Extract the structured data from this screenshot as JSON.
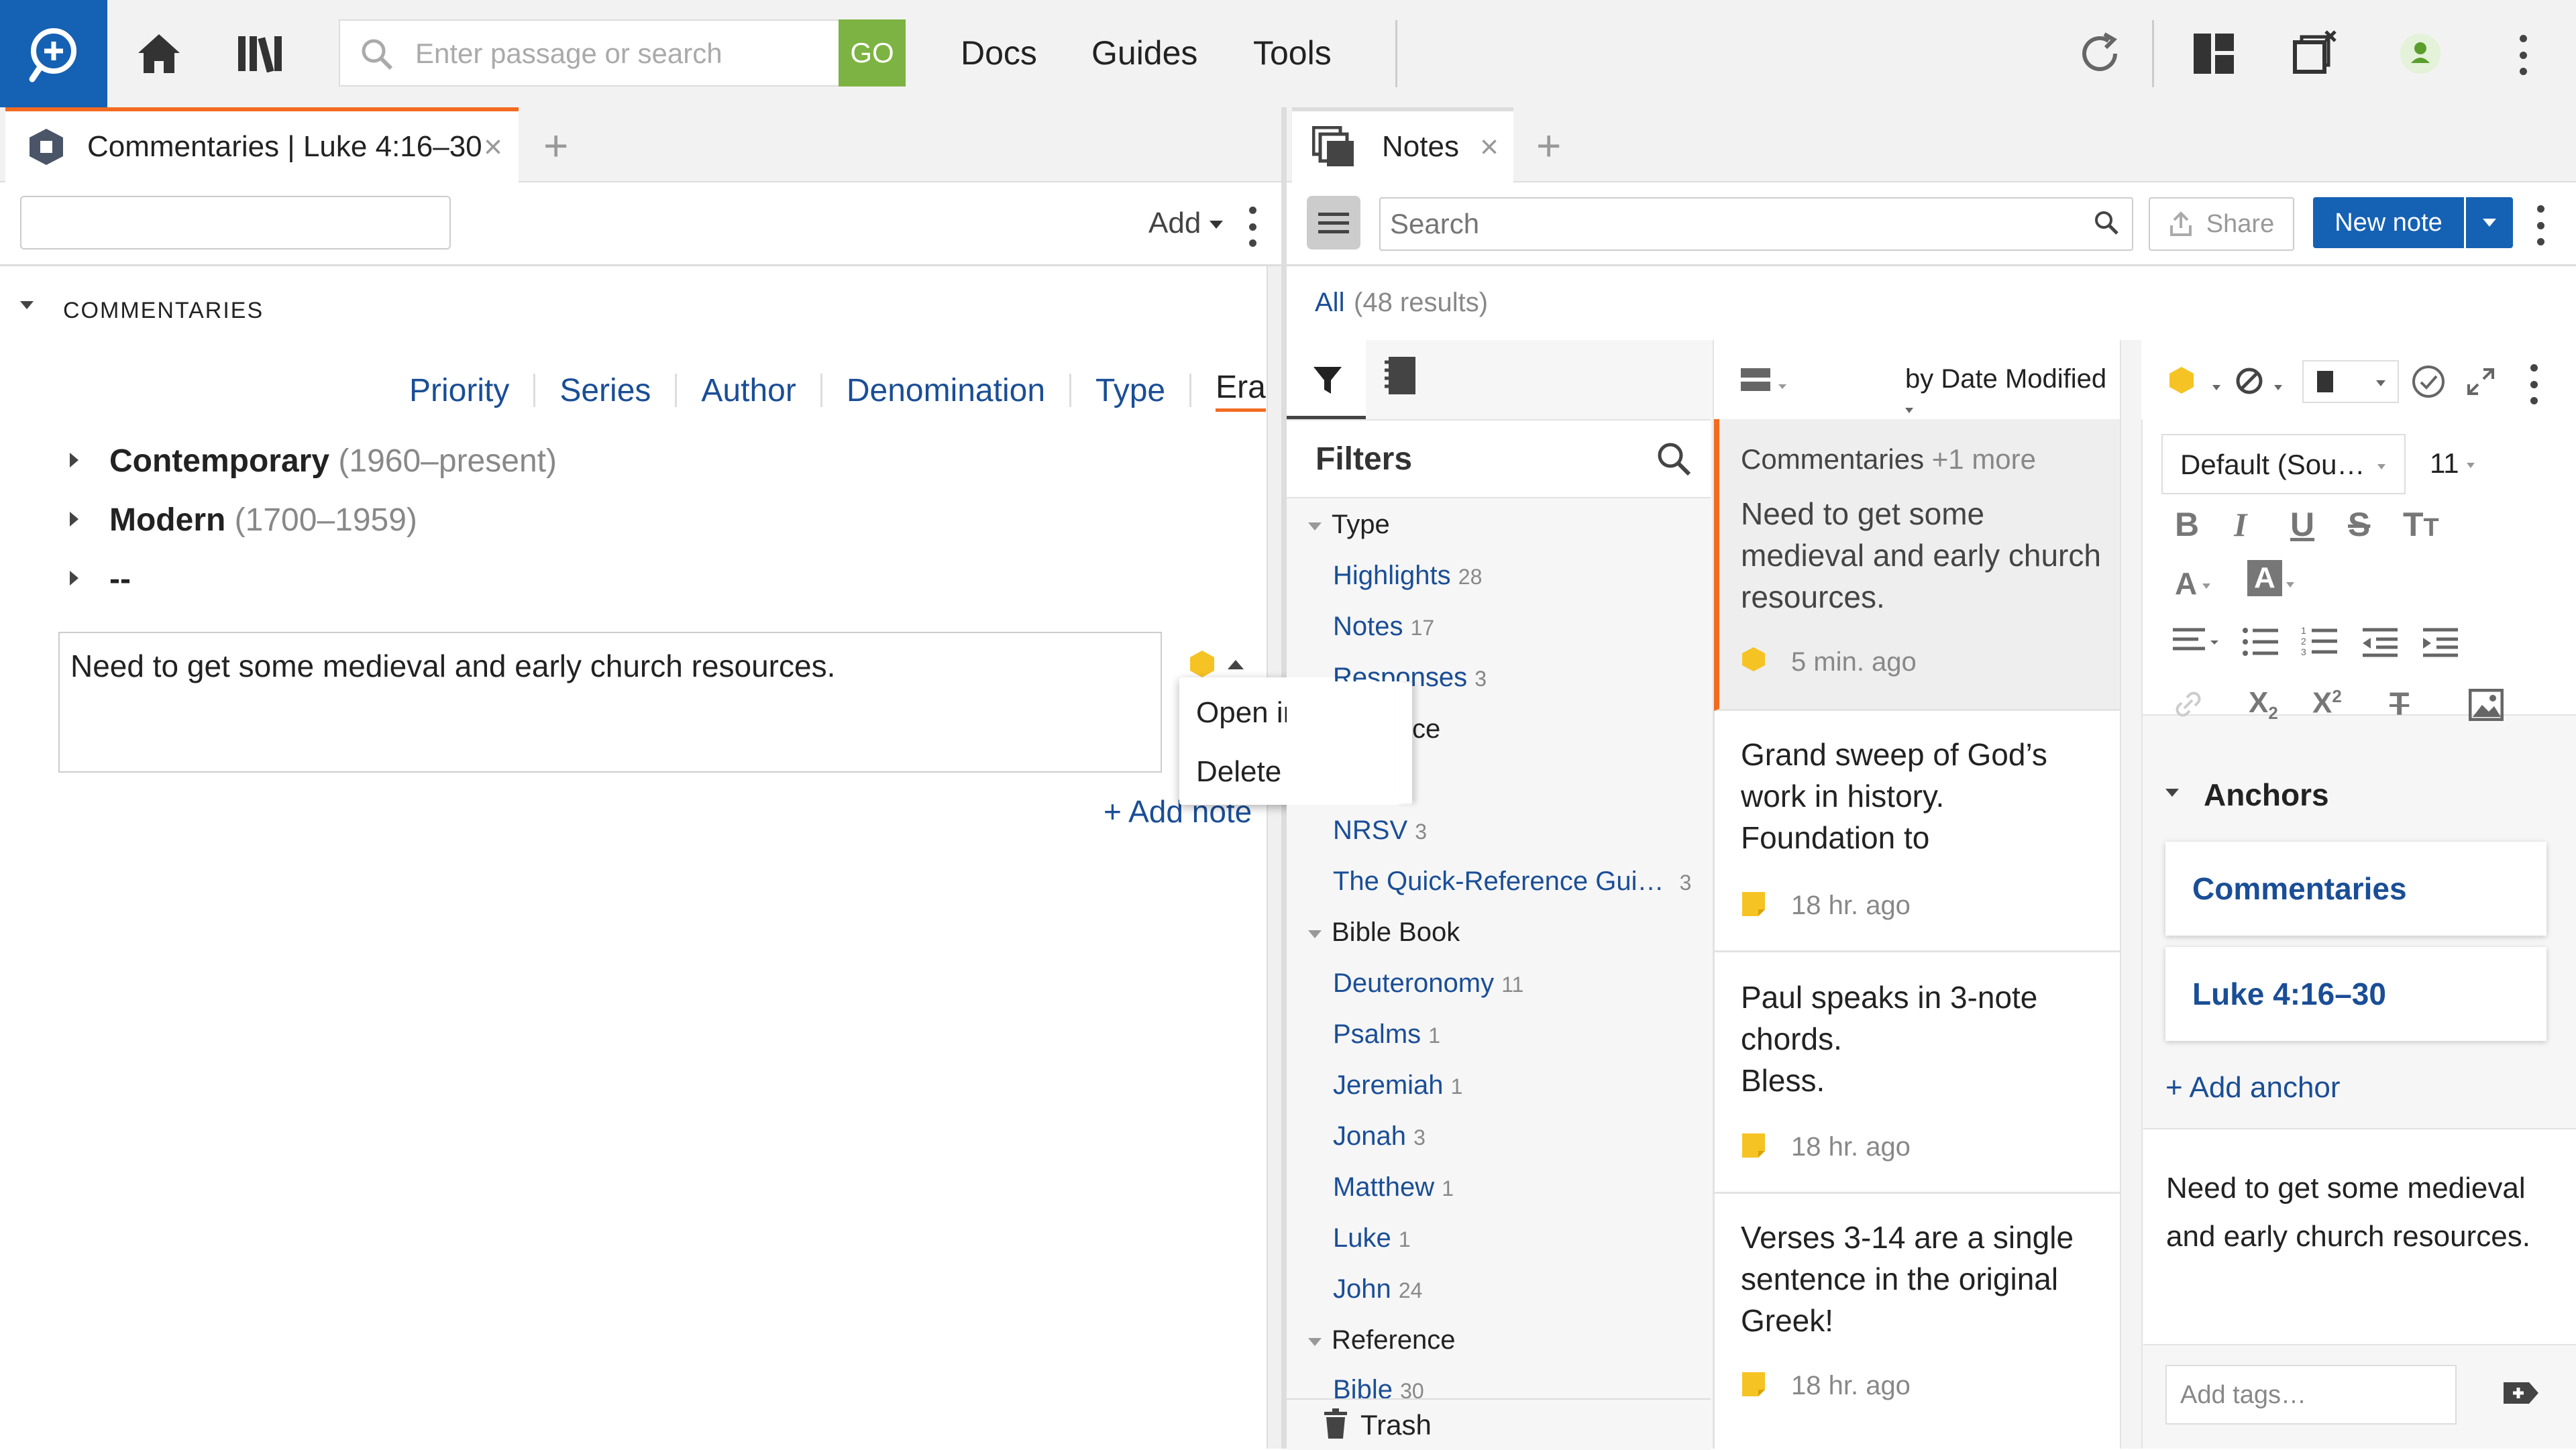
{
  "topbar": {
    "search_placeholder": "Enter passage or search",
    "go_label": "GO",
    "nav": [
      "Docs",
      "Guides",
      "Tools"
    ]
  },
  "left_panel": {
    "tab_title": "Commentaries | Luke 4:16–30",
    "add_label": "Add",
    "section_title": "COMMENTARIES",
    "sort_tabs": [
      "Priority",
      "Series",
      "Author",
      "Denomination",
      "Type",
      "Era"
    ],
    "active_sort": "Era",
    "eras": [
      {
        "name": "Contemporary",
        "range": "(1960–present)"
      },
      {
        "name": "Modern",
        "range": "(1700–1959)"
      },
      {
        "name": "--",
        "range": ""
      }
    ],
    "note_text": "Need to get some medieval and early church resources.",
    "add_note_label": "+ Add note",
    "context_menu": [
      "Open in Notes",
      "Delete"
    ]
  },
  "right_panel": {
    "tab_title": "Notes",
    "search_placeholder": "Search",
    "share_label": "Share",
    "new_note_label": "New note",
    "results_all": "All",
    "results_count": "(48 results)",
    "sort_label": "by Date Modified",
    "filters": {
      "title": "Filters",
      "groups": [
        {
          "heading": "Type",
          "items": [
            {
              "label": "Highlights",
              "count": "28"
            },
            {
              "label": "Notes",
              "count": "17"
            },
            {
              "label": "Responses",
              "count": "3"
            }
          ]
        },
        {
          "heading": "",
          "items": [
            {
              "label": "NRSV",
              "count": "3"
            },
            {
              "label": "The Quick-Reference Gui…",
              "count": "3"
            }
          ]
        },
        {
          "heading": "Bible Book",
          "items": [
            {
              "label": "Deuteronomy",
              "count": "11"
            },
            {
              "label": "Psalms",
              "count": "1"
            },
            {
              "label": "Jeremiah",
              "count": "1"
            },
            {
              "label": "Jonah",
              "count": "3"
            },
            {
              "label": "Matthew",
              "count": "1"
            },
            {
              "label": "Luke",
              "count": "1"
            },
            {
              "label": "John",
              "count": "24"
            }
          ]
        },
        {
          "heading": "Reference",
          "items": [
            {
              "label": "Bible",
              "count": "30"
            }
          ]
        }
      ],
      "partial_label_fragment": "ce",
      "trash_label": "Trash"
    },
    "notes_list": [
      {
        "header": "Commentaries",
        "header_more": "+1 more",
        "text": "Need to get some medieval and early church resources.",
        "time": "5 min. ago",
        "marker": "hexagon"
      },
      {
        "header": "",
        "header_more": "",
        "text": "Grand sweep of God’s work in history. Foundation to",
        "time": "18 hr. ago",
        "marker": "sticky"
      },
      {
        "header": "",
        "header_more": "",
        "text": "Paul speaks in 3-note chords.\nBless.",
        "time": "18 hr. ago",
        "marker": "sticky"
      },
      {
        "header": "",
        "header_more": "",
        "text": "Verses 3-14 are a single sentence in the original Greek!",
        "time": "18 hr. ago",
        "marker": "sticky"
      }
    ],
    "editor": {
      "font_label": "Default (Sou…",
      "size_label": "11",
      "anchors_title": "Anchors",
      "anchors": [
        "Commentaries",
        "Luke 4:16–30"
      ],
      "add_anchor_label": "+ Add anchor",
      "note_body": "Need to get some medieval and early church resources.",
      "tags_placeholder": "Add tags…"
    }
  },
  "colors": {
    "brand_blue": "#1561b4",
    "go_green": "#7cb342",
    "accent_orange": "#f26b21",
    "link_blue": "#1a4e96",
    "highlight_yellow": "#f6c324"
  }
}
